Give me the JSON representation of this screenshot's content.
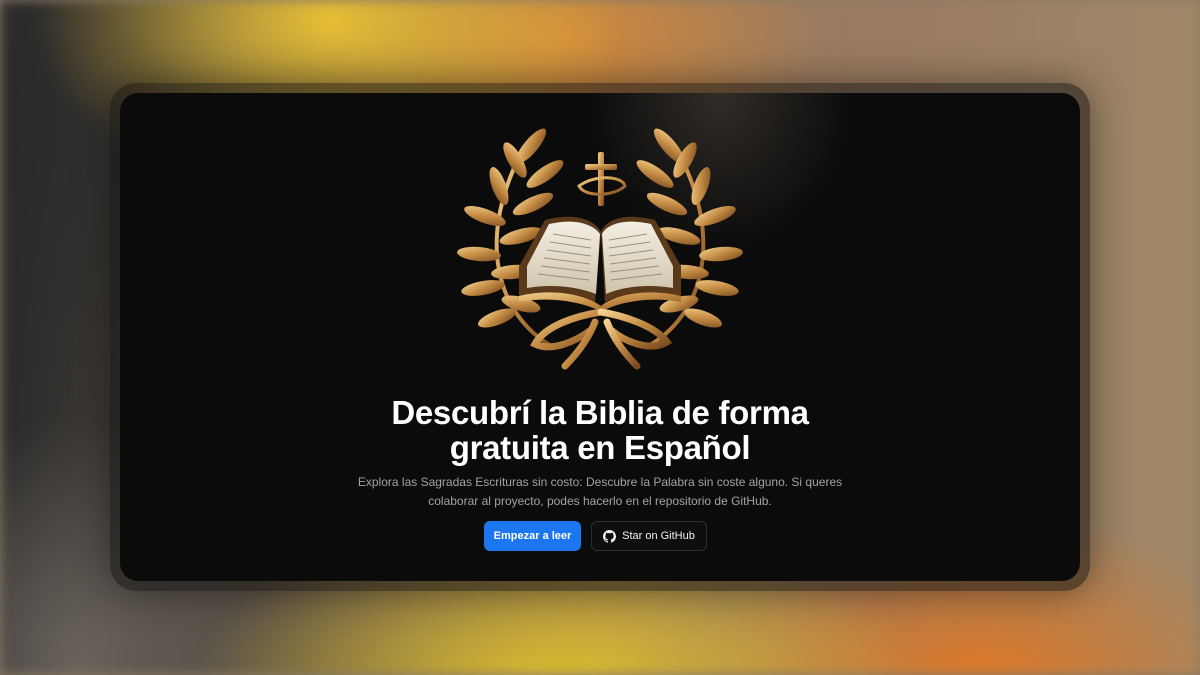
{
  "hero": {
    "title_line1": "Descubrí la Biblia de forma",
    "title_line2": "gratuita en Español",
    "description_line1": "Explora las Sagradas Escrituras sin costo: Descubre la Palabra sin coste alguno. Si queres",
    "description_line2": "colaborar al proyecto, podes hacerlo en el repositorio de GitHub."
  },
  "actions": {
    "primary_label": "Empezar a leer",
    "secondary_label": "Star on GitHub",
    "secondary_icon": "github-icon"
  },
  "emblem": {
    "icon": "bible-laurel-emblem",
    "accent_color": "#c9974a"
  },
  "colors": {
    "primary_button": "#1c76f0",
    "panel_background": "#0b0b0c",
    "text_primary": "#ffffff",
    "text_secondary": "#a3a3a3"
  }
}
